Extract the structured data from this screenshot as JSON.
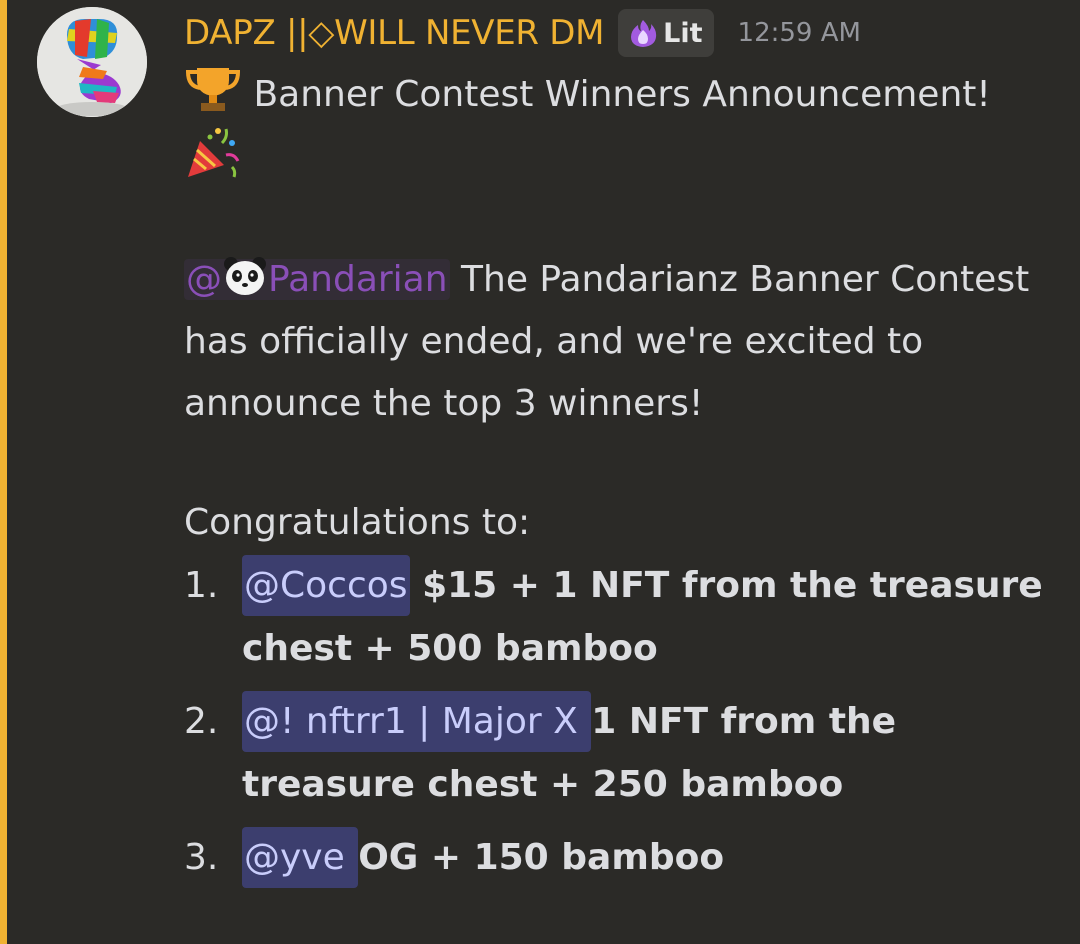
{
  "message": {
    "author": "DAPZ ||◇WILL NEVER DM",
    "tag": {
      "icon": "flame-icon",
      "label": "Lit"
    },
    "timestamp": "12:59 AM",
    "title_emoji": "trophy-icon",
    "title": "Banner Contest Winners Announcement!",
    "party_emoji": "party-popper-icon",
    "role_mention": {
      "prefix": "@",
      "icon": "panda-icon",
      "name": "Pandarian"
    },
    "body": " The Pandarianz Banner Contest has officially ended, and we're excited to announce the top 3 winners!",
    "congrats": "Congratulations to:",
    "winners": [
      {
        "num": "1.",
        "mention": "@Coccos",
        "prize": " $15 + 1 NFT from the treasure chest + 500 bamboo"
      },
      {
        "num": "2.",
        "mention": "@! nftrr1 |  Major X ",
        "prize": " 1 NFT from the treasure chest + 250 bamboo"
      },
      {
        "num": "3.",
        "mention": "@yve ",
        "prize": " OG + 150 bamboo"
      }
    ]
  },
  "colors": {
    "username": "#f0b232",
    "accent_border": "#f0b232",
    "role_mention": "#8a4fb8",
    "user_mention_bg": "#3c3e6e",
    "user_mention_text": "#c9cdfb",
    "background": "#2b2a27"
  }
}
